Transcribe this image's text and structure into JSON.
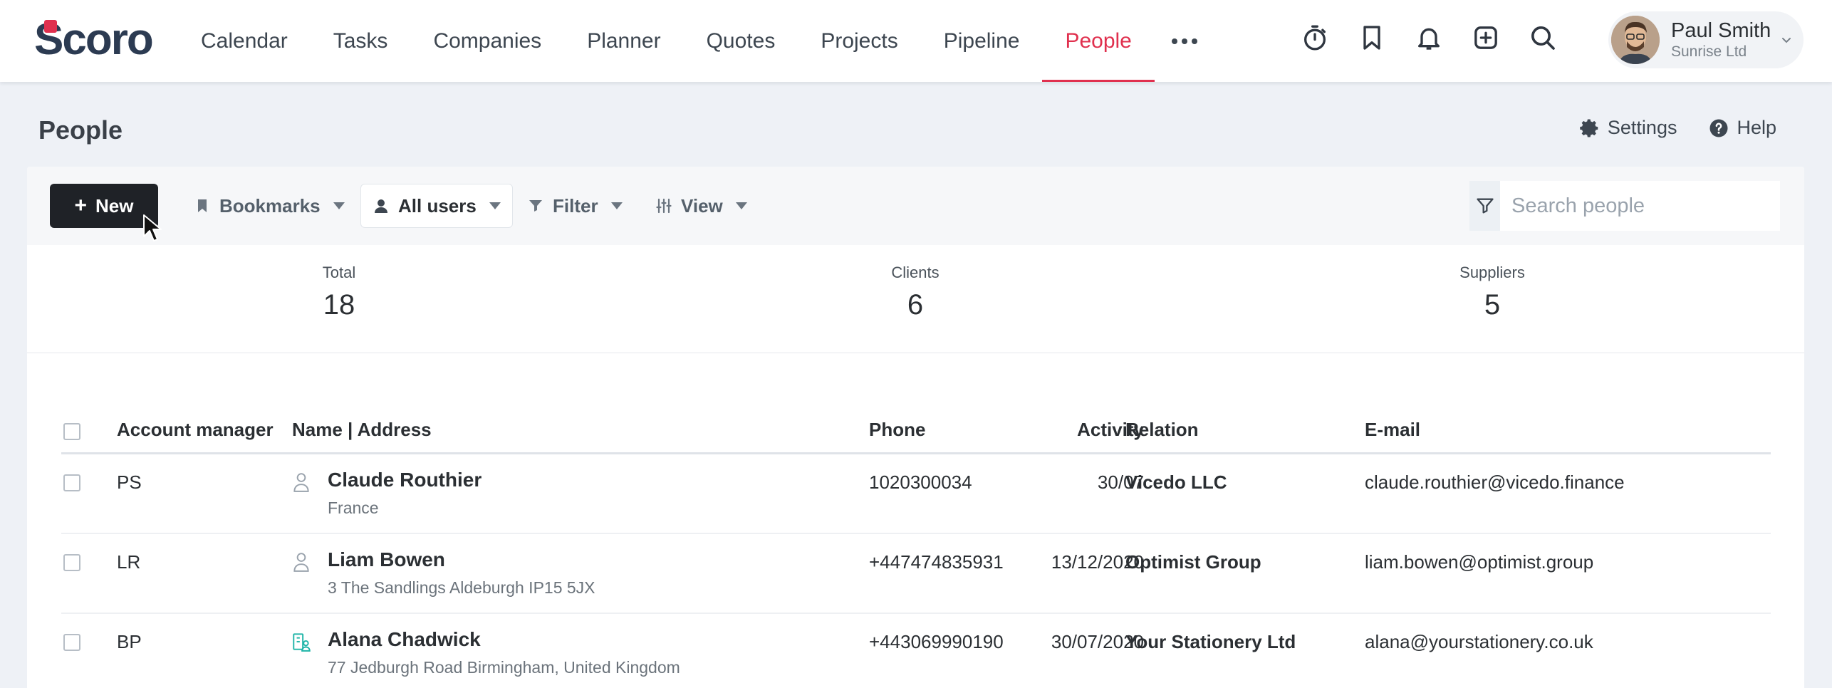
{
  "app": {
    "logo_text": "Scoro",
    "brand_color": "#e0304e"
  },
  "nav": {
    "items": [
      {
        "label": "Calendar"
      },
      {
        "label": "Tasks"
      },
      {
        "label": "Companies"
      },
      {
        "label": "Planner"
      },
      {
        "label": "Quotes"
      },
      {
        "label": "Projects"
      },
      {
        "label": "Pipeline"
      },
      {
        "label": "People",
        "active": true
      }
    ],
    "more_icon": "more-dots-icon"
  },
  "top_icons": [
    "timer-icon",
    "bookmark-icon",
    "bell-icon",
    "add-square-icon",
    "search-icon"
  ],
  "user": {
    "name": "Paul Smith",
    "company": "Sunrise Ltd"
  },
  "page": {
    "title": "People",
    "actions": {
      "settings": "Settings",
      "help": "Help"
    }
  },
  "toolbar": {
    "new_label": "New",
    "bookmarks_label": "Bookmarks",
    "users_label": "All users",
    "filter_label": "Filter",
    "view_label": "View",
    "search_placeholder": "Search people",
    "search_value": ""
  },
  "stats": {
    "total": {
      "label": "Total",
      "value": "18"
    },
    "clients": {
      "label": "Clients",
      "value": "6"
    },
    "suppliers": {
      "label": "Suppliers",
      "value": "5"
    }
  },
  "table": {
    "columns": {
      "manager": "Account manager",
      "name": "Name | Address",
      "phone": "Phone",
      "activity": "Activity",
      "relation": "Relation",
      "email": "E-mail"
    },
    "rows": [
      {
        "manager": "PS",
        "name": "Claude Routhier",
        "address": "France",
        "phone": "1020300034",
        "activity": "30/07",
        "relation": "Vicedo LLC",
        "email": "claude.routhier@vicedo.finance",
        "icon": "person-icon"
      },
      {
        "manager": "LR",
        "name": "Liam Bowen",
        "address": "3 The Sandlings Aldeburgh IP15 5JX",
        "phone": "+447474835931",
        "activity": "13/12/2020",
        "relation": "Optimist Group",
        "email": "liam.bowen@optimist.group",
        "icon": "person-icon"
      },
      {
        "manager": "BP",
        "name": "Alana Chadwick",
        "address": "77 Jedburgh Road Birmingham, United Kingdom",
        "phone": "+443069990190",
        "activity": "30/07/2020",
        "relation": "Your Stationery Ltd",
        "email": "alana@yourstationery.co.uk",
        "icon": "company-contact-icon"
      }
    ]
  }
}
